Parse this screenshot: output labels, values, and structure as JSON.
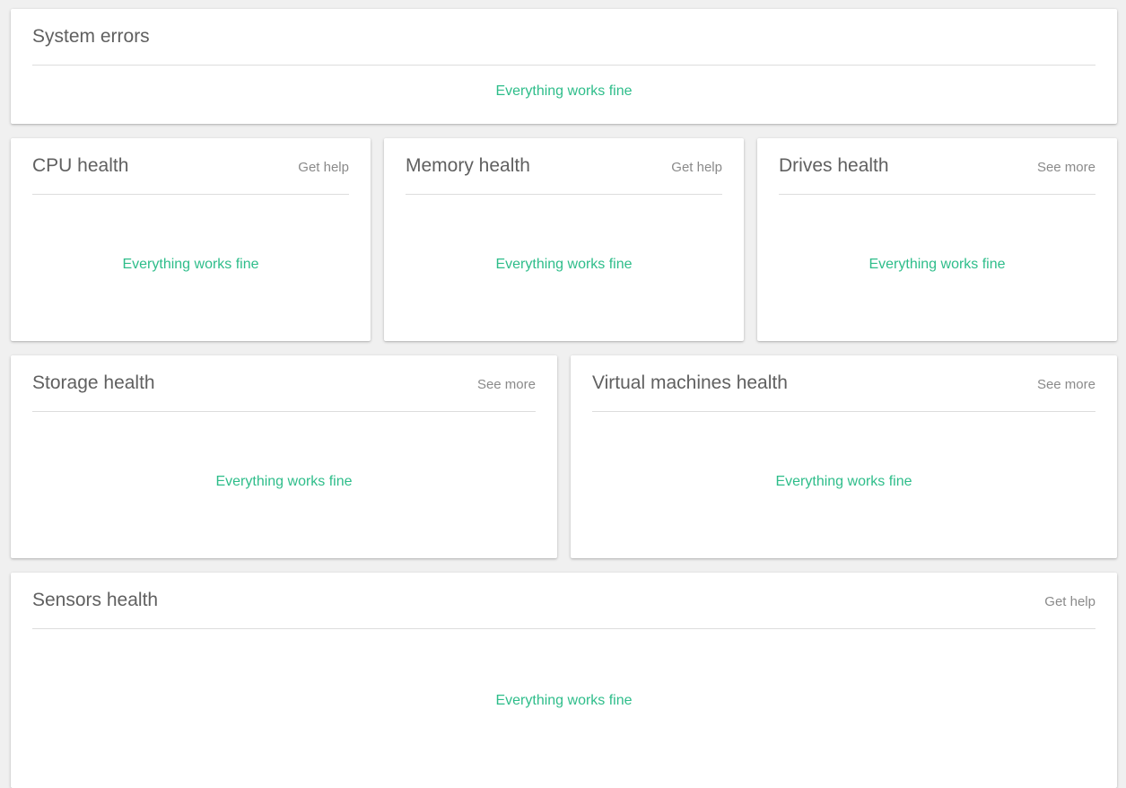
{
  "theme": {
    "status_ok_color": "#2ebd8a",
    "background": "#f0f0f0"
  },
  "cards": {
    "system_errors": {
      "title": "System errors",
      "status": "Everything works fine"
    },
    "cpu": {
      "title": "CPU health",
      "link": "Get help",
      "status": "Everything works fine"
    },
    "memory": {
      "title": "Memory health",
      "link": "Get help",
      "status": "Everything works fine"
    },
    "drives": {
      "title": "Drives health",
      "link": "See more",
      "status": "Everything works fine"
    },
    "storage": {
      "title": "Storage health",
      "link": "See more",
      "status": "Everything works fine"
    },
    "virtual_machines": {
      "title": "Virtual machines health",
      "link": "See more",
      "status": "Everything works fine"
    },
    "sensors": {
      "title": "Sensors health",
      "link": "Get help",
      "status": "Everything works fine"
    }
  }
}
